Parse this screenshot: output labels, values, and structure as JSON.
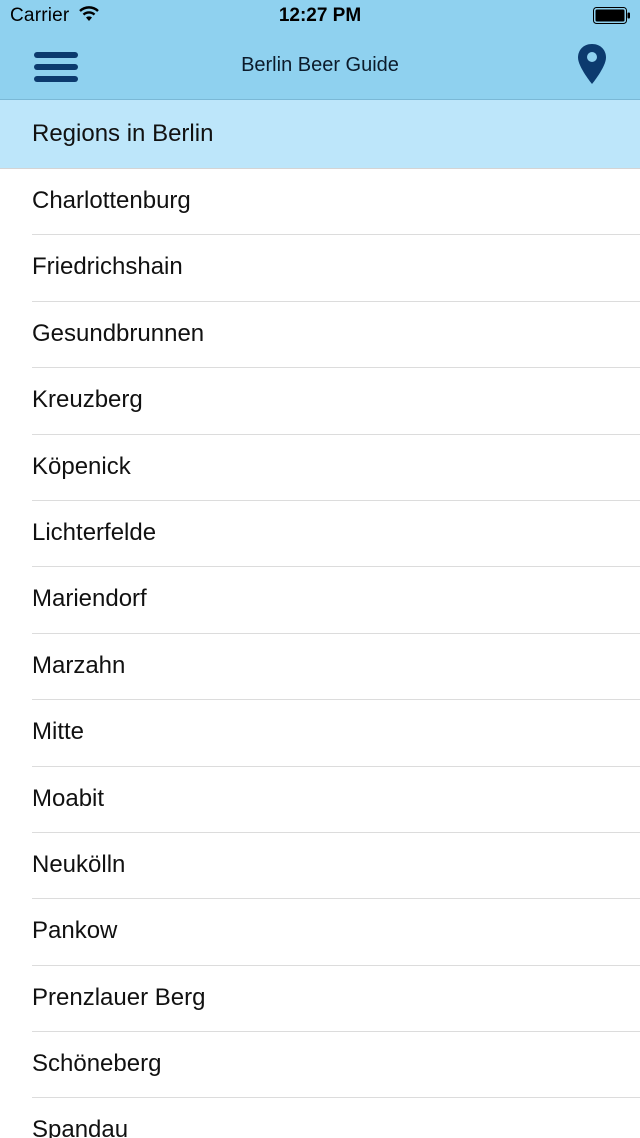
{
  "status_bar": {
    "carrier": "Carrier",
    "time": "12:27 PM",
    "wifi_icon": "wifi-icon",
    "battery_icon": "battery-icon"
  },
  "nav": {
    "title": "Berlin Beer Guide",
    "menu_icon": "hamburger-menu-icon",
    "location_icon": "map-pin-icon"
  },
  "section": {
    "title": "Regions in Berlin"
  },
  "regions": [
    "Charlottenburg",
    "Friedrichshain",
    "Gesundbrunnen",
    "Kreuzberg",
    "Köpenick",
    "Lichterfelde",
    "Mariendorf",
    "Marzahn",
    "Mitte",
    "Moabit",
    "Neukölln",
    "Pankow",
    "Prenzlauer Berg",
    "Schöneberg",
    "Spandau"
  ],
  "colors": {
    "nav_background": "#8fd1ef",
    "section_header_background": "#bde6fa",
    "icon_color": "#0c3a6e"
  }
}
